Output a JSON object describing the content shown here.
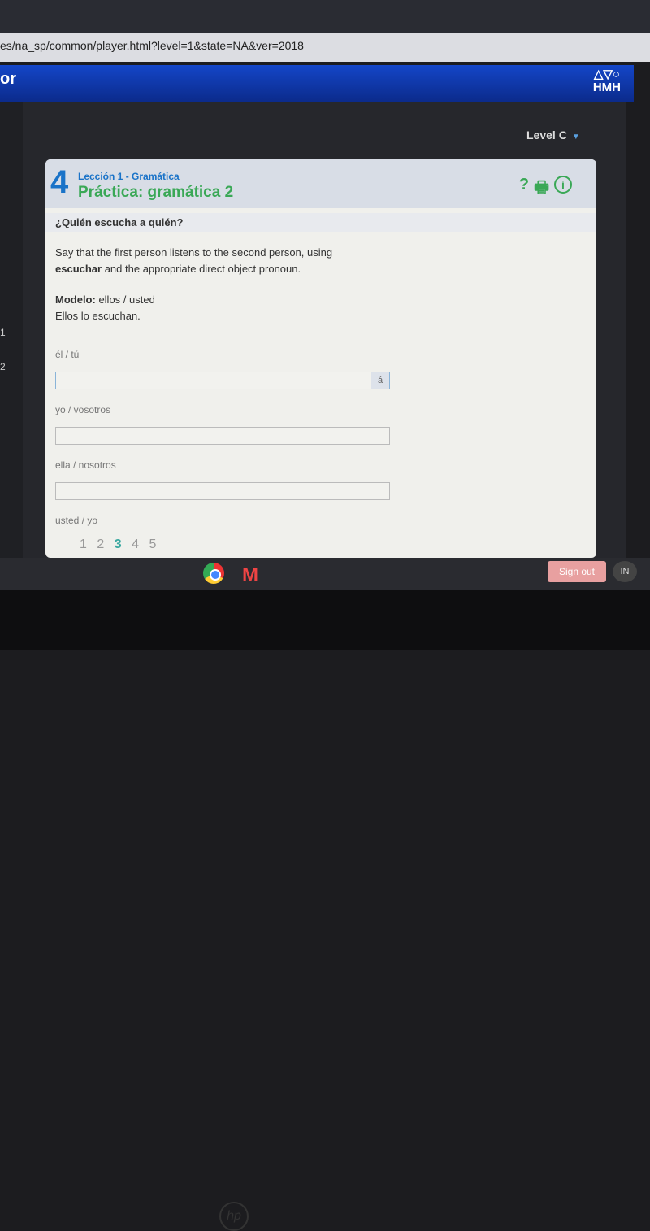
{
  "browser": {
    "url": "es/na_sp/common/player.html?level=1&state=NA&ver=2018"
  },
  "header": {
    "brand_fragment": "or",
    "logo": "HMH"
  },
  "sidebar": {
    "items": [
      "1",
      "2"
    ]
  },
  "level_select": {
    "value": "Level C"
  },
  "card": {
    "number": "4",
    "lesson": "Lección 1 - Gramática",
    "title": "Práctica: gramática 2",
    "icons": [
      "help-icon",
      "print-icon",
      "info-icon"
    ],
    "question": "¿Quién escucha a quién?",
    "instructions_1": "Say that the first person listens to the second person, using ",
    "instructions_bold": "escuchar",
    "instructions_2": " and the appropriate direct object pronoun.",
    "model_label": "Modelo:",
    "model_prompt": " ellos / usted",
    "model_answer": "Ellos lo escuchan.",
    "items": [
      {
        "prompt": "él / tú",
        "value": ""
      },
      {
        "prompt": "yo / vosotros",
        "value": ""
      },
      {
        "prompt": "ella / nosotros",
        "value": ""
      },
      {
        "prompt": "usted / yo",
        "value": ""
      }
    ],
    "accent_button": "á",
    "pages": [
      "1",
      "2",
      "3",
      "4",
      "5"
    ],
    "current_page": "3"
  },
  "shelf": {
    "sign_out": "Sign out",
    "lang": "IN"
  },
  "colors": {
    "accent_blue": "#1a73c8",
    "title_green": "#3aa856",
    "header_blue": "#1446c8"
  }
}
